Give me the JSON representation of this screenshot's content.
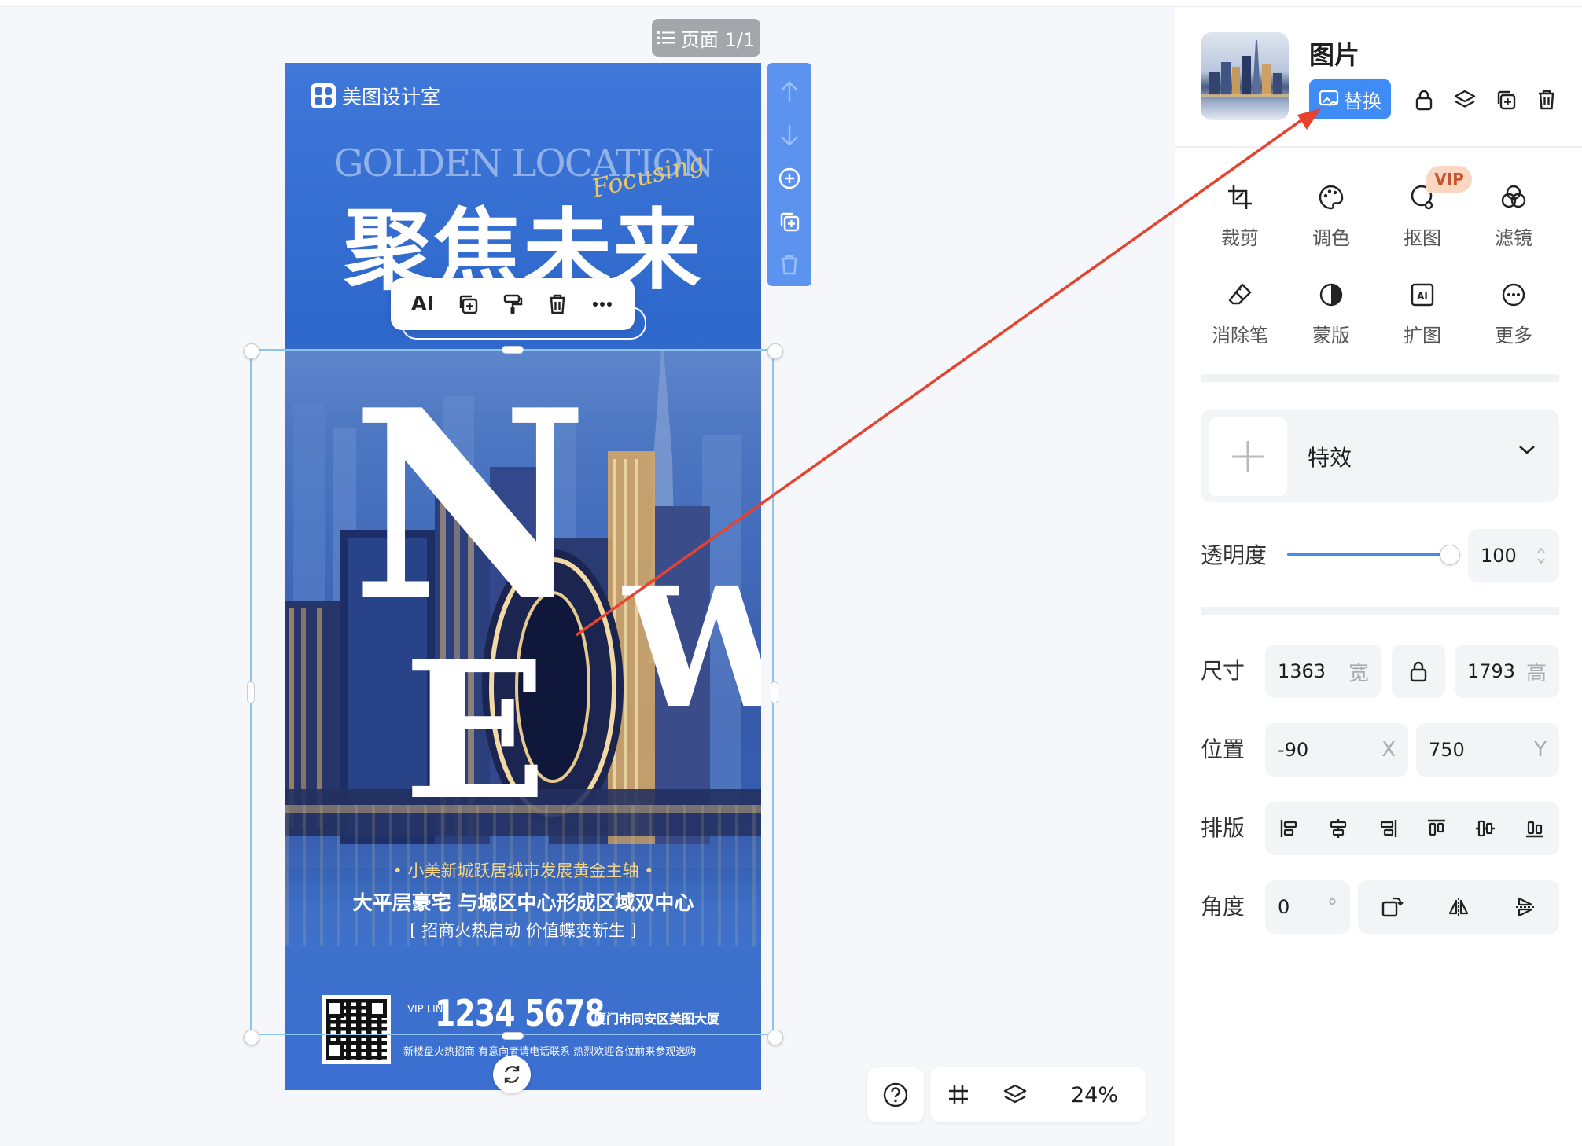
{
  "page_indicator": "页面 1/1",
  "poster": {
    "brand": "美图设计室",
    "golden": "GOLDEN LOCATION",
    "focusing": "Focusing",
    "headline": "聚焦未来",
    "letters": {
      "n": "N",
      "e": "E",
      "w": "W"
    },
    "tagline1": "• 小美新城跃居城市发展黄金主轴 •",
    "tagline2": "大平层豪宅 与城区中心形成区域双中心",
    "tagline3": "[ 招商火热启动 价值蝶变新生 ]",
    "vip_line": "VIP LINE",
    "phone": "1234 5678",
    "address": "厦门市同安区美图大厦",
    "footer": "新楼盘火热招商 有意向者请电话联系 热烈欢迎各位前来参观选购"
  },
  "element_toolbar": {
    "ai_label": "AI"
  },
  "zoom": {
    "level": "24%"
  },
  "panel": {
    "title": "图片",
    "replace_label": "替换",
    "tools": [
      {
        "label": "裁剪",
        "icon": "crop-icon"
      },
      {
        "label": "调色",
        "icon": "palette-icon"
      },
      {
        "label": "抠图",
        "icon": "cutout-icon"
      },
      {
        "label": "滤镜",
        "icon": "filter-icon"
      },
      {
        "label": "消除笔",
        "icon": "eraser-icon"
      },
      {
        "label": "蒙版",
        "icon": "mask-icon"
      },
      {
        "label": "扩图",
        "icon": "expand-icon"
      },
      {
        "label": "更多",
        "icon": "more-icon"
      }
    ],
    "vip_badge": "VIP",
    "effect_label": "特效",
    "opacity": {
      "label": "透明度",
      "value": "100",
      "fraction": 1.0
    },
    "size": {
      "label": "尺寸",
      "width": "1363",
      "width_unit": "宽",
      "height": "1793",
      "height_unit": "高"
    },
    "position": {
      "label": "位置",
      "x": "-90",
      "x_unit": "X",
      "y": "750",
      "y_unit": "Y"
    },
    "layout_label": "排版",
    "angle": {
      "label": "角度",
      "value": "0",
      "unit": "°"
    }
  },
  "colors": {
    "accent": "#3f8cf7",
    "poster_blue": "#3a72d6",
    "annotation_arrow": "#e5432f"
  }
}
